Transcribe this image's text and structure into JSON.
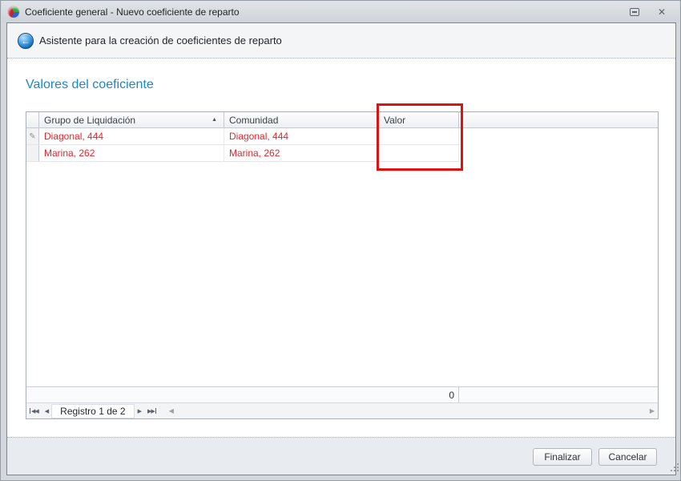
{
  "window": {
    "title": "Coeficiente general - Nuevo coeficiente de reparto"
  },
  "wizard_header": {
    "title": "Asistente para la creación de coeficientes de reparto"
  },
  "section": {
    "title": "Valores del coeficiente"
  },
  "grid": {
    "columns": [
      {
        "label": "Grupo de Liquidación",
        "sort": "asc"
      },
      {
        "label": "Comunidad",
        "sort": ""
      },
      {
        "label": "Valor",
        "sort": ""
      }
    ],
    "rows": [
      {
        "grupo": "Diagonal, 444",
        "comunidad": "Diagonal, 444",
        "valor": "",
        "editing": true
      },
      {
        "grupo": "Marina, 262",
        "comunidad": "Marina, 262",
        "valor": "",
        "editing": false
      }
    ],
    "summary": {
      "valor": "0"
    },
    "navigator": {
      "label": "Registro 1 de 2"
    }
  },
  "buttons": {
    "finalizar": "Finalizar",
    "cancelar": "Cancelar"
  },
  "icons": {
    "back": "←",
    "sort_asc": "▲",
    "edit_row": "✎",
    "nav_first": "◀◀",
    "nav_prev": "◀",
    "nav_next": "▶",
    "nav_last": "▶▶",
    "scroll_left": "◀",
    "scroll_right": "▶",
    "close": "✕"
  },
  "colors": {
    "accent_blue": "#1e86c7",
    "record_red": "#e8232a",
    "annotation_red": "#df1212"
  },
  "annotation": {
    "shape": "rectangle",
    "target": "Valor column header and cells"
  }
}
